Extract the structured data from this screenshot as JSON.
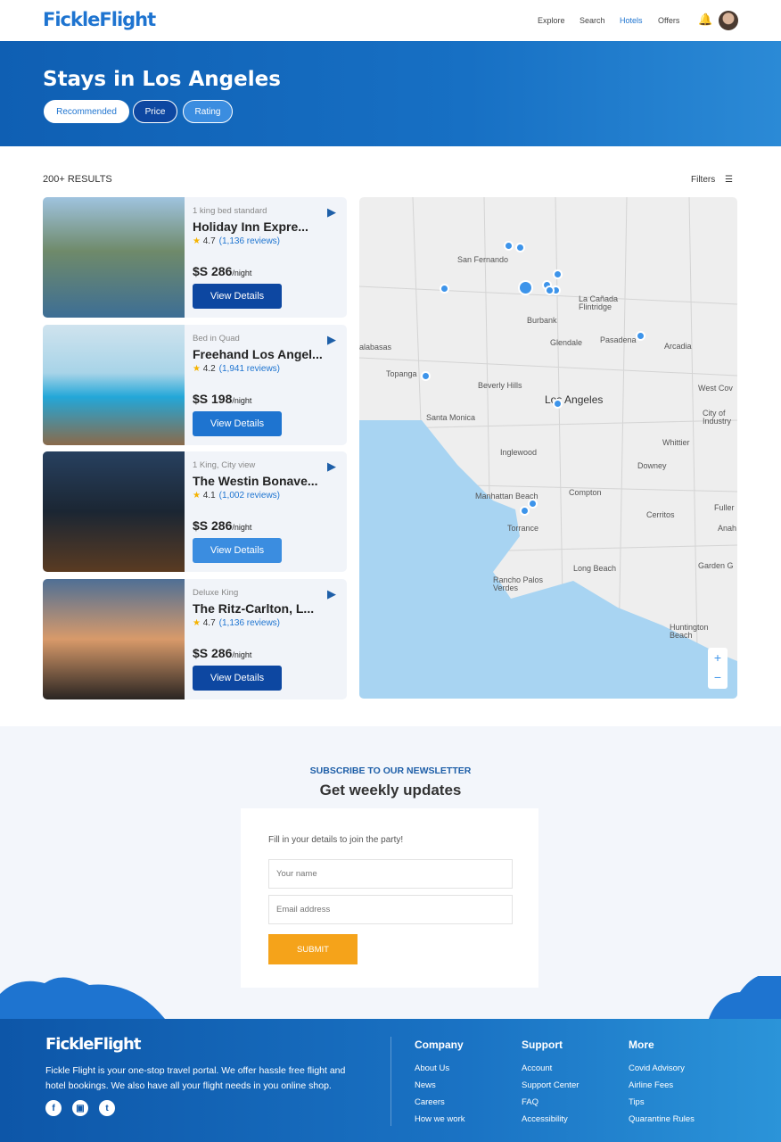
{
  "header": {
    "logo": "FickleFlight",
    "nav": [
      "Explore",
      "Search",
      "Hotels",
      "Offers"
    ],
    "active": "Hotels"
  },
  "hero": {
    "title": "Stays in Los Angeles",
    "chips": [
      "Recommended",
      "Price",
      "Rating"
    ]
  },
  "results": {
    "count": "200+ RESULTS",
    "filters": "Filters"
  },
  "hotels": [
    {
      "room": "1 king bed standard",
      "name": "Holiday Inn Expre...",
      "rating": "4.7",
      "reviews": "(1,136 reviews)",
      "price": "$S 286",
      "unit": "/night",
      "button": "View Details",
      "btn_color": "#0d47a1"
    },
    {
      "room": "Bed in Quad",
      "name": "Freehand Los Angel...",
      "rating": "4.2",
      "reviews": "(1,941 reviews)",
      "price": "$S 198",
      "unit": "/night",
      "button": "View Details",
      "btn_color": "#1e74d0"
    },
    {
      "room": "1 King, City view",
      "name": "The Westin Bonave...",
      "rating": "4.1",
      "reviews": "(1,002 reviews)",
      "price": "$S 286",
      "unit": "/night",
      "button": "View Details",
      "btn_color": "#3b8de0"
    },
    {
      "room": "Deluxe King",
      "name": "The Ritz-Carlton, L...",
      "rating": "4.7",
      "reviews": "(1,136 reviews)",
      "price": "$S 286",
      "unit": "/night",
      "button": "View Details",
      "btn_color": "#0d47a1"
    }
  ],
  "map": {
    "labels": [
      "San Fernando",
      "Burbank",
      "La Cañada Flintridge",
      "Glendale",
      "Pasadena",
      "Arcadia",
      "alabasas",
      "Topanga",
      "Beverly Hills",
      "Los Angeles",
      "West Cov",
      "Santa Monica",
      "City of Industry",
      "Whittier",
      "Inglewood",
      "Downey",
      "Manhattan Beach",
      "Compton",
      "Torrance",
      "Cerritos",
      "Fuller",
      "Anah",
      "Long Beach",
      "Garden G",
      "Rancho Palos Verdes",
      "Huntington Beach"
    ],
    "zoom_in": "+",
    "zoom_out": "−"
  },
  "newsletter": {
    "eyebrow": "SUBSCRIBE TO OUR NEWSLETTER",
    "title": "Get weekly updates",
    "prompt": "Fill in your details to join the party!",
    "name_placeholder": "Your name",
    "email_placeholder": "Email address",
    "submit": "SUBMIT"
  },
  "footer": {
    "logo": "FickleFlight",
    "about": "Fickle Flight is your one-stop travel portal. We offer hassle free flight and hotel bookings. We also have all your flight needs in you online shop.",
    "columns": [
      {
        "title": "Company",
        "links": [
          "About Us",
          "News",
          "Careers",
          "How we work"
        ]
      },
      {
        "title": "Support",
        "links": [
          "Account",
          "Support Center",
          "FAQ",
          "Accessibility"
        ]
      },
      {
        "title": "More",
        "links": [
          "Covid Advisory",
          "Airline Fees",
          "Tips",
          "Quarantine Rules"
        ]
      }
    ]
  }
}
